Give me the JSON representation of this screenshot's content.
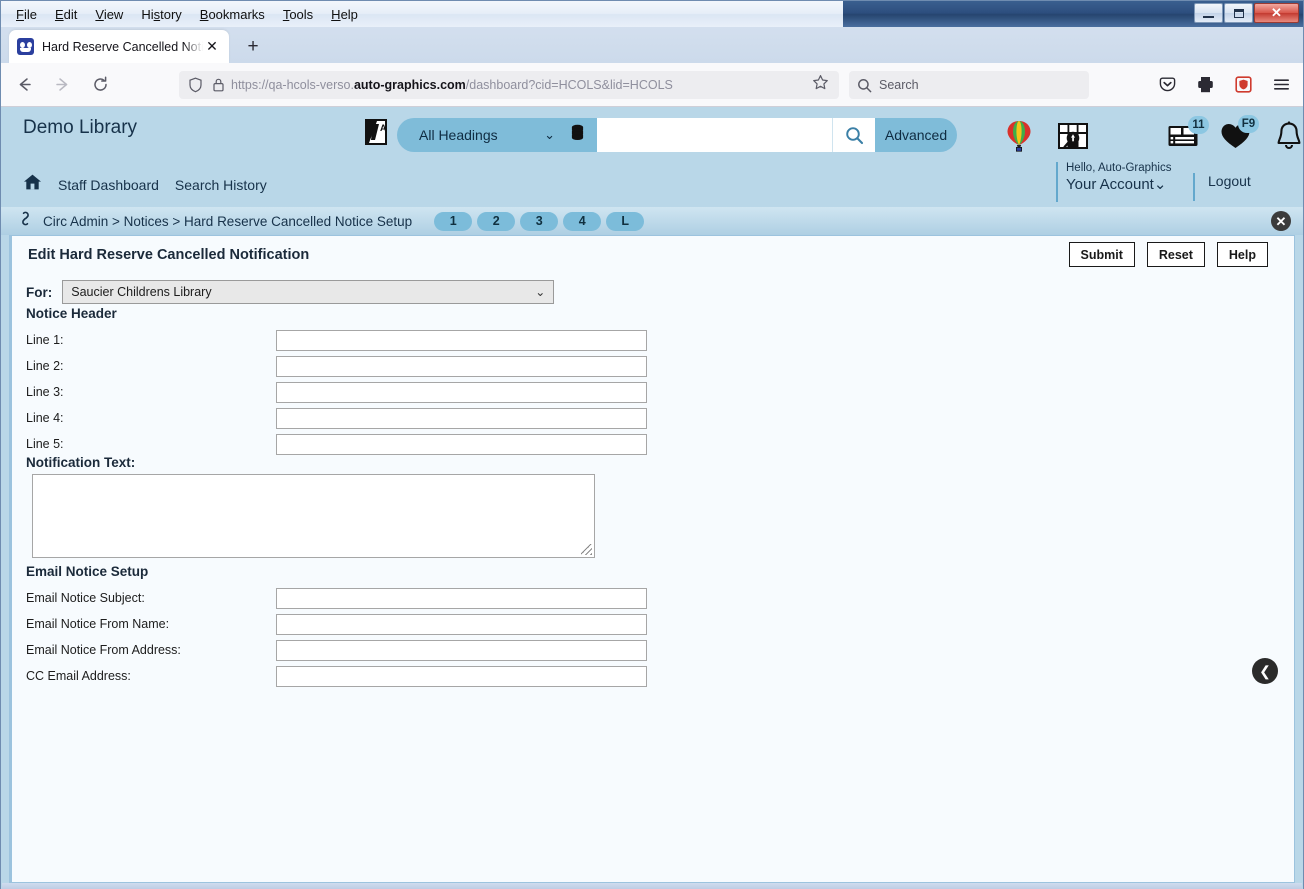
{
  "os": {
    "menus": [
      "File",
      "Edit",
      "View",
      "History",
      "Bookmarks",
      "Tools",
      "Help"
    ],
    "minimize_label": "Minimize",
    "maximize_label": "Maximize",
    "close_label": "✕"
  },
  "browser": {
    "tab_title": "Hard Reserve Cancelled Notice Setup",
    "tab_close_label": "✕",
    "new_tab_label": "+",
    "url_prefix": "https://qa-hcols-verso.",
    "url_domain": "auto-graphics.com",
    "url_suffix": "/dashboard?cid=HCOLS&lid=HCOLS",
    "search_placeholder": "Search"
  },
  "app": {
    "brand": "Demo Library",
    "search": {
      "scope_label": "All Headings",
      "query_value": "",
      "advanced_label": "Advanced"
    },
    "badges": {
      "list_count": "11",
      "favorites_count": "F9"
    },
    "nav": {
      "staff_dashboard": "Staff Dashboard",
      "search_history": "Search History"
    },
    "account": {
      "hello": "Hello, Auto-Graphics",
      "your_account": "Your Account",
      "chevron": "⌄",
      "logout": "Logout"
    },
    "breadcrumb": {
      "text": "Circ Admin > Notices > Hard Reserve Cancelled Notice Setup",
      "pills": [
        "1",
        "2",
        "3",
        "4",
        "L"
      ],
      "close_label": "✕"
    }
  },
  "page": {
    "title": "Edit Hard Reserve Cancelled Notification",
    "buttons": {
      "submit": "Submit",
      "reset": "Reset",
      "help": "Help"
    },
    "for": {
      "label": "For:",
      "value": "Saucier Childrens Library",
      "chevron": "⌄"
    },
    "notice_header": {
      "heading": "Notice Header",
      "fields": [
        {
          "label": "Line 1:",
          "value": ""
        },
        {
          "label": "Line 2:",
          "value": ""
        },
        {
          "label": "Line 3:",
          "value": ""
        },
        {
          "label": "Line 4:",
          "value": ""
        },
        {
          "label": "Line 5:",
          "value": ""
        }
      ]
    },
    "notification_text": {
      "heading": "Notification Text:",
      "value": ""
    },
    "email_notice": {
      "heading": "Email Notice Setup",
      "fields": [
        {
          "label": "Email Notice Subject:",
          "value": ""
        },
        {
          "label": "Email Notice From Name:",
          "value": ""
        },
        {
          "label": "Email Notice From Address:",
          "value": ""
        },
        {
          "label": "CC Email Address:",
          "value": ""
        }
      ]
    },
    "sidebar_toggle_label": "❮"
  },
  "colors": {
    "app_header_bg": "#b9d7e8",
    "accent": "#7fbcd9",
    "panel_bg": "#f7fbfe",
    "panel_border": "#9cc3de",
    "titlebar_blue": "#2d4e7e"
  }
}
